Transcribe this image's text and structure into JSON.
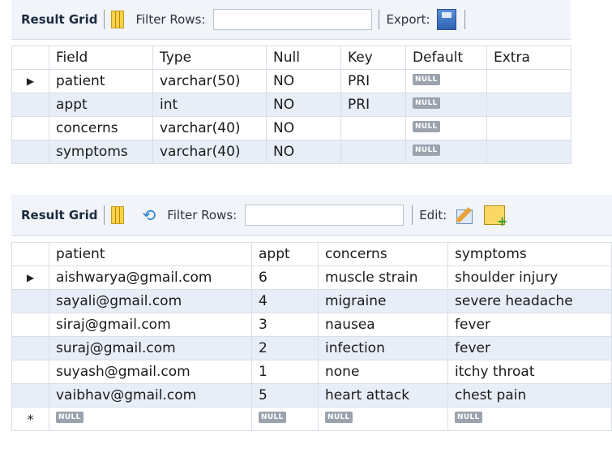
{
  "top": {
    "toolbar": {
      "result_grid_label": "Result Grid",
      "filter_rows_label": "Filter Rows:",
      "filter_value": "",
      "export_label": "Export:"
    },
    "columns": [
      "Field",
      "Type",
      "Null",
      "Key",
      "Default",
      "Extra"
    ],
    "null_label": "NULL",
    "rows": [
      {
        "field": "patient",
        "type": "varchar(50)",
        "null": "NO",
        "key": "PRI",
        "default": "NULL",
        "extra": ""
      },
      {
        "field": "appt",
        "type": "int",
        "null": "NO",
        "key": "PRI",
        "default": "NULL",
        "extra": ""
      },
      {
        "field": "concerns",
        "type": "varchar(40)",
        "null": "NO",
        "key": "",
        "default": "NULL",
        "extra": ""
      },
      {
        "field": "symptoms",
        "type": "varchar(40)",
        "null": "NO",
        "key": "",
        "default": "NULL",
        "extra": ""
      }
    ],
    "selected_row_marker": "▶"
  },
  "bottom": {
    "toolbar": {
      "result_grid_label": "Result Grid",
      "filter_rows_label": "Filter Rows:",
      "filter_value": "",
      "edit_label": "Edit:"
    },
    "columns": [
      "patient",
      "appt",
      "concerns",
      "symptoms"
    ],
    "rows": [
      {
        "patient": "aishwarya@gmail.com",
        "appt": "6",
        "concerns": "muscle strain",
        "symptoms": "shoulder injury"
      },
      {
        "patient": "sayali@gmail.com",
        "appt": "4",
        "concerns": "migraine",
        "symptoms": "severe headache"
      },
      {
        "patient": "siraj@gmail.com",
        "appt": "3",
        "concerns": "nausea",
        "symptoms": "fever"
      },
      {
        "patient": "suraj@gmail.com",
        "appt": "2",
        "concerns": "infection",
        "symptoms": "fever"
      },
      {
        "patient": "suyash@gmail.com",
        "appt": "1",
        "concerns": "none",
        "symptoms": "itchy throat"
      },
      {
        "patient": "vaibhav@gmail.com",
        "appt": "5",
        "concerns": "heart attack",
        "symptoms": "chest pain"
      }
    ],
    "new_row": {
      "patient": "NULL",
      "appt": "NULL",
      "concerns": "NULL",
      "symptoms": "NULL",
      "marker": "*"
    },
    "selected_row_marker": "▶"
  }
}
